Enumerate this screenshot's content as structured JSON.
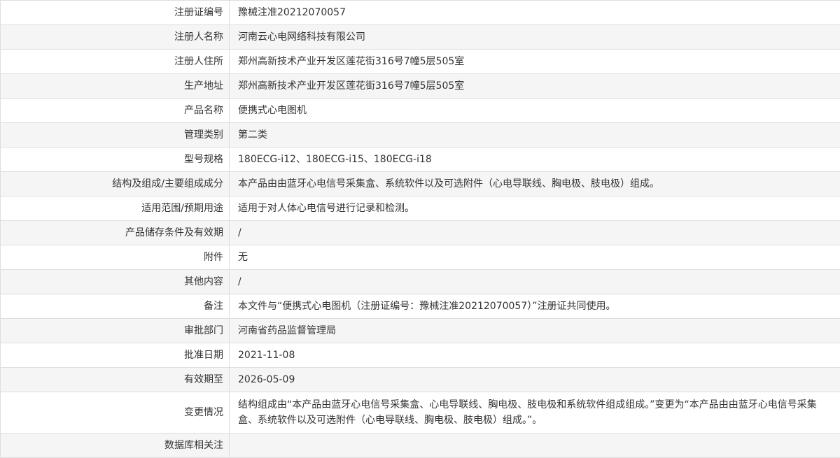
{
  "colors": {
    "row_bg": "#ffffff",
    "row_alt": "#f5f5f5",
    "border": "#dedede",
    "text": "#333333"
  },
  "rows": [
    {
      "label": "注册证编号",
      "value": "豫械注准20212070057"
    },
    {
      "label": "注册人名称",
      "value": "河南云心电网络科技有限公司"
    },
    {
      "label": "注册人住所",
      "value": "郑州高新技术产业开发区莲花街316号7幢5层505室"
    },
    {
      "label": "生产地址",
      "value": "郑州高新技术产业开发区莲花街316号7幢5层505室"
    },
    {
      "label": "产品名称",
      "value": "便携式心电图机"
    },
    {
      "label": "管理类别",
      "value": "第二类"
    },
    {
      "label": "型号规格",
      "value": "180ECG-i12、180ECG-i15、180ECG-i18"
    },
    {
      "label": "结构及组成/主要组成成分",
      "value": "本产品由由蓝牙心电信号采集盒、系统软件以及可选附件（心电导联线、胸电极、肢电极）组成。"
    },
    {
      "label": "适用范围/预期用途",
      "value": "适用于对人体心电信号进行记录和检测。"
    },
    {
      "label": "产品储存条件及有效期",
      "value": "/"
    },
    {
      "label": "附件",
      "value": "无"
    },
    {
      "label": "其他内容",
      "value": "/"
    },
    {
      "label": "备注",
      "value": "本文件与“便携式心电图机（注册证编号：豫械注准20212070057）”注册证共同使用。"
    },
    {
      "label": "审批部门",
      "value": "河南省药品监督管理局"
    },
    {
      "label": "批准日期",
      "value": "2021-11-08"
    },
    {
      "label": "有效期至",
      "value": "2026-05-09"
    },
    {
      "label": "变更情况",
      "value": "结构组成由“本产品由蓝牙心电信号采集盒、心电导联线、胸电极、肢电极和系统软件组成组成。”变更为“本产品由由蓝牙心电信号采集盒、系统软件以及可选附件（心电导联线、胸电极、肢电极）组成。”。"
    },
    {
      "label": "数据库相关注"
    }
  ]
}
